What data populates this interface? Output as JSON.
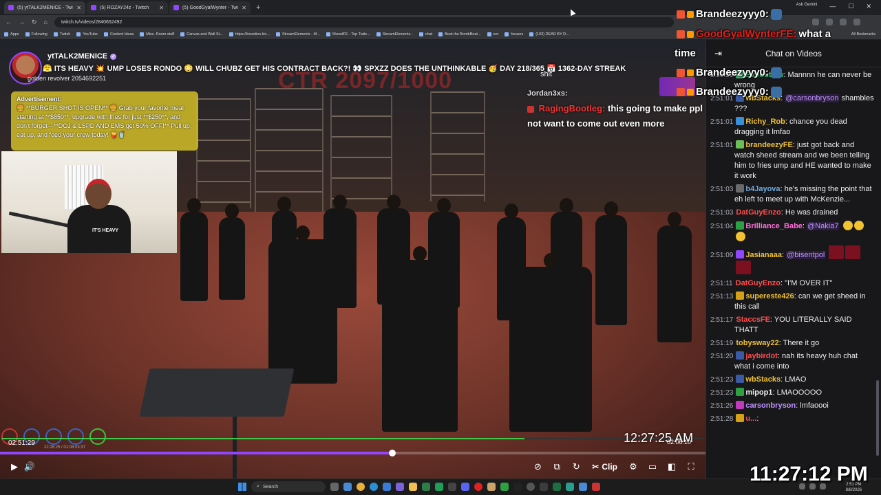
{
  "browser": {
    "tabs": [
      {
        "label": "(5) ytTALK2MENICE - Twitch",
        "active": true
      },
      {
        "label": "(5) ROZAY24z - Twitch",
        "active": false
      },
      {
        "label": "(5) GoodGyalWynter - Twitch",
        "active": false
      }
    ],
    "new_tab": "+",
    "url": "twitch.tv/videos/2840652492",
    "ask_gemini": "Ask Gemini",
    "bookmarks": [
      "Apps",
      "Following",
      "Twitch",
      "YouTube",
      "Content Ideas",
      "Misc. Room stuff",
      "Canvas and Wall St...",
      "https://bounties.kic...",
      "StreamElements - M...",
      "SheedFE - Top Twitc...",
      "StreamElements -",
      "chat",
      "Beat the BombBeat...",
      "oor",
      "houses",
      "(103) DEAD BY D..."
    ],
    "all_bookmarks": "All Bookmarks"
  },
  "video": {
    "streamer_name": "ytTALK2MENICE",
    "headline": "😤 ITS HEAVY 💥 UMP LOSES RONDO 😳 WILL CHUBZ GET HIS CONTRACT BACK?! 👀 SPXZZ DOES THE UNTHINKABLE 🥳 DAY 218/365 📅 1362-DAY STREAK",
    "overlay_revolver": "golden revolver 2054692251",
    "ad": {
      "title": "Advertisement:",
      "body": "🍔 **BURGER SHOT IS OPEN** 🍔 Grab your favorite meal starting at **$850**, upgrade with fries for just **$250**, and don't forget—**DOJ & LSPD AND EMS get 50% OFF!** Pull up, eat up, and feed your crew today! 🍟🥤"
    },
    "webcam_shirt": "IT'S HEAVY",
    "game_title": "CTR 2097/1000",
    "game_chat": {
      "top_word": "shit",
      "user1": "Jordan3xs:",
      "user2": "RagingBootleg:",
      "message": "this going to make ppl not want to come out even more"
    },
    "game_clock": "12:27:25 AM",
    "inner_vod_time": "02:06:10",
    "inner_vod_position": "22:28:25 / 01:08:03:37",
    "current_time": "02:51:29",
    "progress_played_fraction": 0.556,
    "inner_progress_fraction": 0.745,
    "controls": {
      "play": "▶",
      "volume": "🔊",
      "clip": "Clip",
      "settings": "⚙",
      "theatre": "▭",
      "sidebar": "◧",
      "fullscreen": "⛶"
    }
  },
  "chat": {
    "title": "Chat on Videos",
    "collapse": "⇥",
    "messages": [
      {
        "ts": "2:50:59",
        "badge": "#3cb371",
        "user": "Evooutlaw",
        "color": "#2ecc71",
        "mention": "",
        "text": "Mannnn he can never be wrong"
      },
      {
        "ts": "2:51:01",
        "badge": "#3a5aa5",
        "user": "wbStacks",
        "color": "#f1c232",
        "mention": "@carsonbryson",
        "text": "shambles ???"
      },
      {
        "ts": "2:51:01",
        "badge": "#3a8fd9",
        "user": "Richy_Rob",
        "color": "#f1c232",
        "mention": "",
        "text": "chance you dead dragging it lmfao"
      },
      {
        "ts": "2:51:01",
        "badge": "#6bbf59",
        "user": "brandeezyFE",
        "color": "#f1c232",
        "mention": "",
        "text": "just got back and watch sheed stream and we been telling him to fries ump and HE wanted to make it work"
      },
      {
        "ts": "2:51:03",
        "badge": "#6a6a6a",
        "user": "b4Jayova",
        "color": "#6fa8dc",
        "mention": "",
        "text": "he's missing the point that eh left to meet up with McKenzie..."
      },
      {
        "ts": "2:51:03",
        "badge": "",
        "user": "DatGuyEnzo",
        "color": "#ff4d4d",
        "mention": "",
        "text": "He was drained"
      },
      {
        "ts": "2:51:04",
        "badge": "#2ea043",
        "user": "Brilliance_Babe",
        "color": "#ff6fd8",
        "mention": "@Nakia7",
        "text": ""
      },
      {
        "ts": "2:51:09",
        "badge": "#9146ff",
        "user": "Jasianaaa",
        "color": "#f1c232",
        "mention": "@bisentpol",
        "text": ""
      },
      {
        "ts": "2:51:11",
        "badge": "",
        "user": "DatGuyEnzo",
        "color": "#ff4d4d",
        "mention": "",
        "text": "\"I'M OVER IT\""
      },
      {
        "ts": "2:51:13",
        "badge": "#d4a017",
        "user": "supereste426",
        "color": "#f1c232",
        "mention": "",
        "text": "can we get sheed in this call"
      },
      {
        "ts": "2:51:17",
        "badge": "",
        "user": "StaccsFE",
        "color": "#ff4d4d",
        "mention": "",
        "text": "YOU LITERALLY SAID THATT"
      },
      {
        "ts": "2:51:19",
        "badge": "",
        "user": "tobysway22",
        "color": "#f1c232",
        "mention": "",
        "text": "There it go"
      },
      {
        "ts": "2:51:20",
        "badge": "#3a5aa5",
        "user": "jaybirdot",
        "color": "#ff4d4d",
        "mention": "",
        "text": "nah its heavy huh chat what i come into"
      },
      {
        "ts": "2:51:23",
        "badge": "#3a5aa5",
        "user": "wbStacks",
        "color": "#f1c232",
        "mention": "",
        "text": "LMAO"
      },
      {
        "ts": "2:51:23",
        "badge": "#2ea043",
        "user": "mipop1",
        "color": "#efeff1",
        "mention": "",
        "text": "LMAOOOOO"
      },
      {
        "ts": "2:51:26",
        "badge": "#c03ab9",
        "user": "carsonbryson",
        "color": "#bf94ff",
        "mention": "",
        "text": "lmfaoooi"
      },
      {
        "ts": "2:51:28",
        "badge": "#d4a017",
        "user": "u...",
        "color": "#ff4d4d",
        "mention": "",
        "text": ""
      }
    ]
  },
  "overlay_alerts": [
    {
      "user": "Brandeezyyy0:",
      "text": "",
      "red": false
    },
    {
      "user": "GoodGyalWynterFE:",
      "text": "what a",
      "red": true
    },
    {
      "user": "time",
      "text": "",
      "red": false
    },
    {
      "user": "Brandeezyyy0:",
      "text": "",
      "red": false
    },
    {
      "user": "Brandeezyyy0:",
      "text": "",
      "red": false
    }
  ],
  "taskbar": {
    "search": "Search",
    "sys_time": "2:51 PM",
    "sys_date": "8/8/2026"
  },
  "overlay_clock": "11:27:12 PM"
}
